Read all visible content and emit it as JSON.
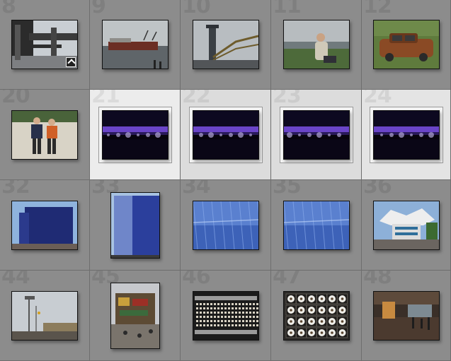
{
  "grid": {
    "cells": [
      {
        "number": "8",
        "photo": "warehouse-crane-detail",
        "has_badge": true
      },
      {
        "number": "9",
        "photo": "cargo-ship-harbor"
      },
      {
        "number": "10",
        "photo": "steel-bridge-tower"
      },
      {
        "number": "11",
        "photo": "man-sitting-riverbank"
      },
      {
        "number": "12",
        "photo": "rusty-car-wreck"
      },
      {
        "number": "20",
        "photo": "two-men-standing"
      },
      {
        "number": "21",
        "photo": "purple-lit-hall",
        "selected": true,
        "active": true
      },
      {
        "number": "22",
        "photo": "purple-lit-hall-2",
        "selected": true
      },
      {
        "number": "23",
        "photo": "purple-lit-hall-3",
        "selected": true
      },
      {
        "number": "24",
        "photo": "purple-lit-hall-4",
        "selected": true,
        "last": true
      },
      {
        "number": "32",
        "photo": "blue-cube-building"
      },
      {
        "number": "33",
        "photo": "blue-cube-building-portrait"
      },
      {
        "number": "34",
        "photo": "blue-water-surface"
      },
      {
        "number": "35",
        "photo": "blue-water-surface-2"
      },
      {
        "number": "36",
        "photo": "white-canopy-pavilion"
      },
      {
        "number": "44",
        "photo": "tower-crowd-fair"
      },
      {
        "number": "45",
        "photo": "colorful-pavilion-crowd"
      },
      {
        "number": "46",
        "photo": "metal-grid-lights"
      },
      {
        "number": "47",
        "photo": "eyeball-shelves"
      },
      {
        "number": "48",
        "photo": "indoor-hall-people"
      }
    ]
  }
}
